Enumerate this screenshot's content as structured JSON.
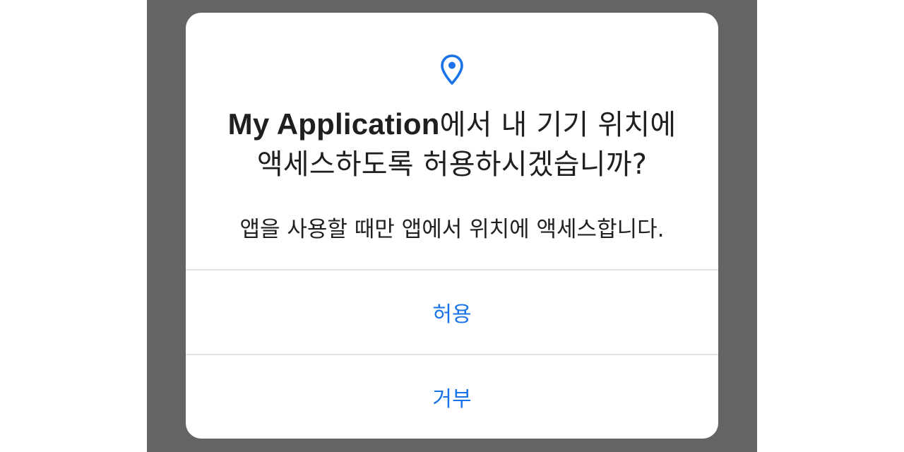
{
  "dialog": {
    "icon": "location-pin-icon",
    "title_app_name": "My Application",
    "title_line1_rest": "에서 내 기기 위치에",
    "title_line2": "액세스하도록 허용하시겠습니까?",
    "message": "앱을 사용할 때만 앱에서 위치에 액세스합니다.",
    "allow_label": "허용",
    "deny_label": "거부"
  },
  "colors": {
    "accent": "#1a73e8",
    "scrim": "#646464",
    "title_text": "#1f1f1f",
    "divider": "#e3e3e3"
  }
}
